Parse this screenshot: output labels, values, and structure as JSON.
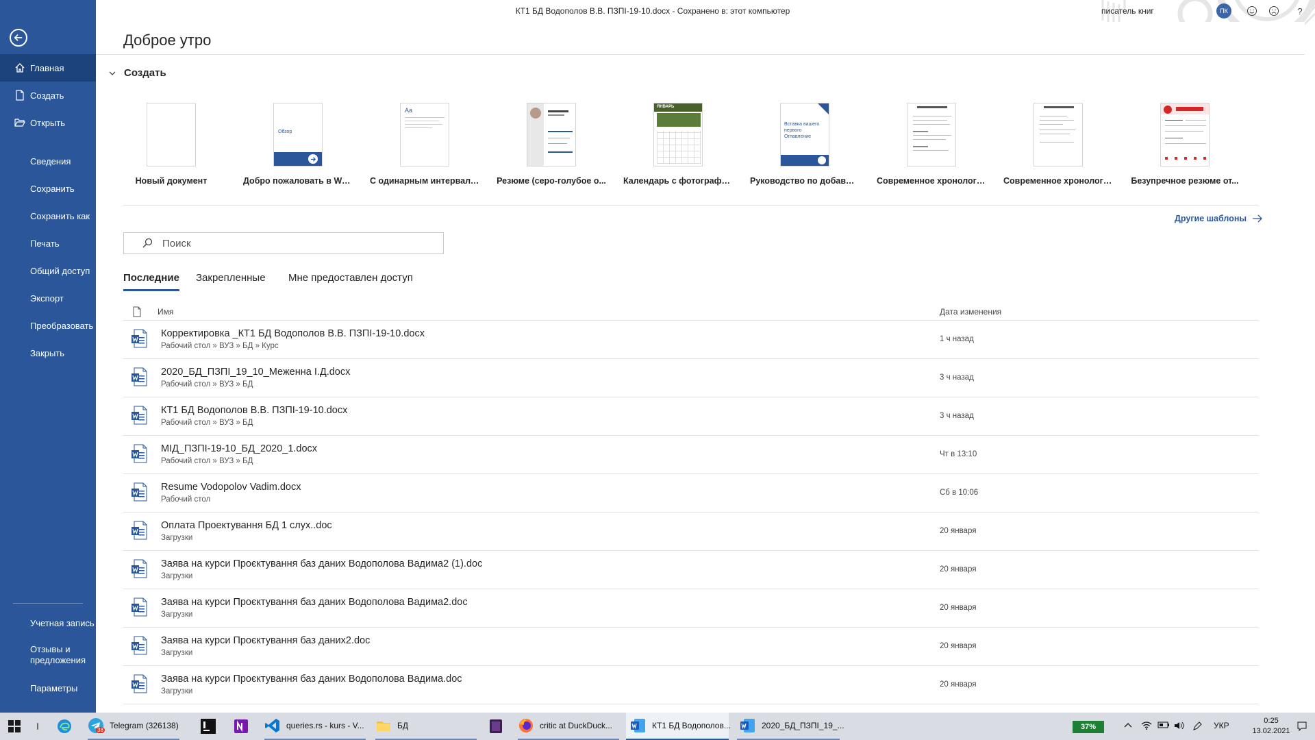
{
  "window": {
    "title": "КТ1 БД Водополов В.В. ПЗПІ-19-10.docx  -  Сохранено в: этот компьютер",
    "user_name": "писатель книг",
    "user_initials": "ПК",
    "help": "?",
    "accent_color": "#2b579a"
  },
  "sidebar": {
    "top_items": [
      {
        "label": "Главная",
        "icon": "home-icon",
        "active": true
      },
      {
        "label": "Создать",
        "icon": "new-doc-icon"
      },
      {
        "label": "Открыть",
        "icon": "folder-open-icon"
      }
    ],
    "mid_items": [
      {
        "label": "Сведения"
      },
      {
        "label": "Сохранить"
      },
      {
        "label": "Сохранить как"
      },
      {
        "label": "Печать"
      },
      {
        "label": "Общий доступ"
      },
      {
        "label": "Экспорт"
      },
      {
        "label": "Преобразовать"
      },
      {
        "label": "Закрыть"
      }
    ],
    "bottom_items": [
      {
        "label": "Учетная запись"
      },
      {
        "label": "Отзывы и предложения"
      },
      {
        "label": "Параметры"
      }
    ]
  },
  "main": {
    "greeting": "Доброе утро",
    "create_section": "Создать",
    "templates": [
      {
        "name": "Новый документ",
        "kind": "blank"
      },
      {
        "name": "Добро пожаловать в Word",
        "kind": "welcome",
        "thumb_text": "Обзор"
      },
      {
        "name": "С одинарным интервало...",
        "kind": "single",
        "thumb_text": "Aa"
      },
      {
        "name": "Резюме (серо-голубое о...",
        "kind": "resume"
      },
      {
        "name": "Календарь с фотографией",
        "kind": "calendar",
        "thumb_text": "ЯНВАРЬ"
      },
      {
        "name": "Руководство по добавле...",
        "kind": "toc",
        "thumb_text": "Вставка вашего первого Оглавление"
      },
      {
        "name": "Современное хронологи...",
        "kind": "chrono1"
      },
      {
        "name": "Современное хронологи...",
        "kind": "chrono2"
      },
      {
        "name": "Безупречное резюме от...",
        "kind": "red"
      }
    ],
    "more_templates": "Другие шаблоны",
    "search_placeholder": "Поиск",
    "tabs": [
      "Последние",
      "Закрепленные",
      "Мне предоставлен доступ"
    ],
    "list_headers": {
      "name": "Имя",
      "date": "Дата изменения"
    },
    "recent_files": [
      {
        "name": "Корректировка _КТ1 БД Водополов В.В. ПЗПІ-19-10.docx",
        "path": "Рабочий стол » ВУЗ » БД » Курс",
        "date": "1 ч назад"
      },
      {
        "name": "2020_БД_ПЗПІ_19_10_Меженна І.Д.docx",
        "path": "Рабочий стол » ВУЗ » БД",
        "date": "3 ч назад"
      },
      {
        "name": "КТ1 БД Водополов В.В. ПЗПІ-19-10.docx",
        "path": "Рабочий стол » ВУЗ » БД",
        "date": "3 ч назад"
      },
      {
        "name": "МІД_ПЗПІ-19-10_БД_2020_1.docx",
        "path": "Рабочий стол » ВУЗ » БД",
        "date": "Чт в 13:10"
      },
      {
        "name": "Resume Vodopolov Vadim.docx",
        "path": "Рабочий стол",
        "date": "Сб в 10:06"
      },
      {
        "name": "Оплата Проектування БД 1 слух..doc",
        "path": "Загрузки",
        "date": "20 января"
      },
      {
        "name": "Заява на курси Проєктування баз даних Водополова Вадима2 (1).doc",
        "path": "Загрузки",
        "date": "20 января"
      },
      {
        "name": "Заява на курси Проєктування баз даних Водополова Вадима2.doc",
        "path": "Загрузки",
        "date": "20 января"
      },
      {
        "name": "Заява на курси Проєктування баз даних2.doc",
        "path": "Загрузки",
        "date": "20 января"
      },
      {
        "name": "Заява на курси Проєктування баз даних Водополова Вадима.doc",
        "path": "Загрузки",
        "date": "20 января"
      }
    ]
  },
  "taskbar": {
    "items": [
      {
        "label": "Telegram (326138)",
        "icon": "telegram-icon",
        "badge": "38"
      },
      {
        "label": "queries.rs - kurs - V...",
        "icon": "vscode-icon"
      },
      {
        "label": "БД",
        "icon": "explorer-folder-icon"
      },
      {
        "label": "critic at DuckDuck...",
        "icon": "firefox-icon"
      },
      {
        "label": "КТ1 БД Водополов...",
        "icon": "word-icon"
      },
      {
        "label": "2020_БД_ПЗПІ_19_...",
        "icon": "word-icon"
      }
    ],
    "battery": "37%",
    "language": "УКР",
    "time": "0:25",
    "date": "13.02.2021"
  }
}
